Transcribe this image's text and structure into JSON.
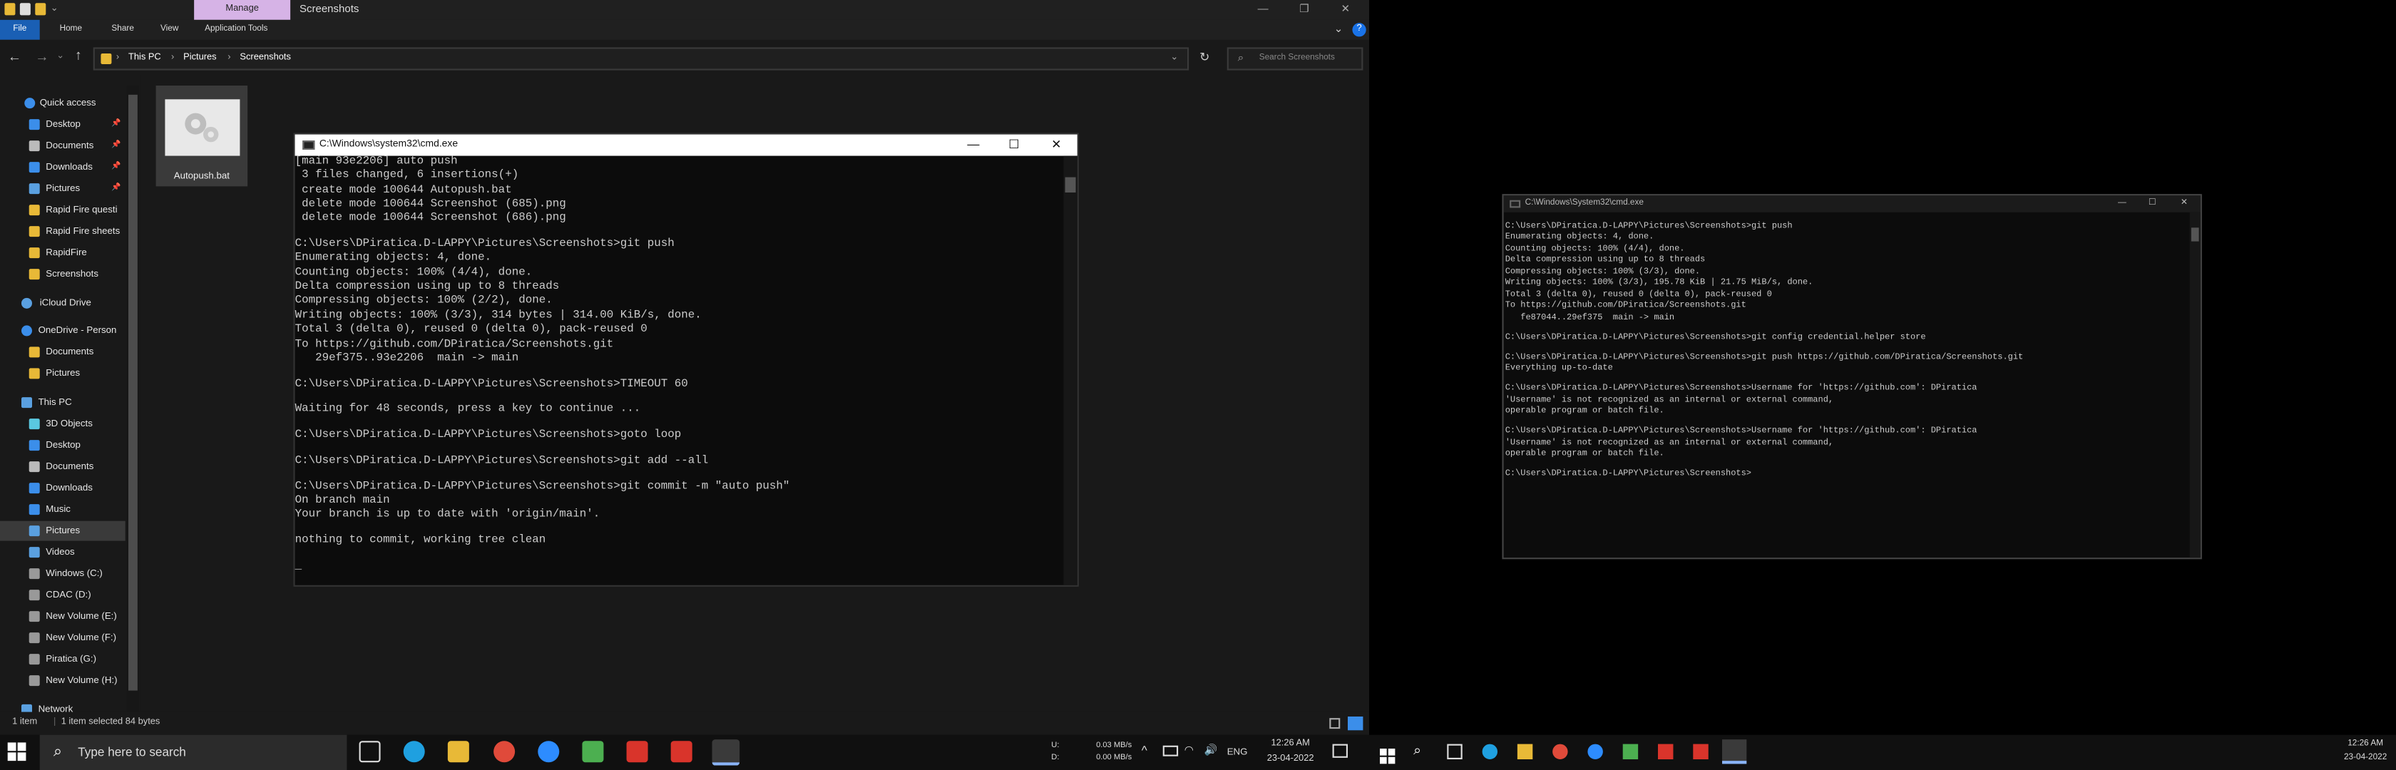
{
  "explorer": {
    "title": "Screenshots",
    "manage_tab": "Manage",
    "ribbon_tabs": [
      "File",
      "Home",
      "Share",
      "View",
      "Application Tools"
    ],
    "breadcrumb": [
      "This PC",
      "Pictures",
      "Screenshots"
    ],
    "search_placeholder": "Search Screenshots",
    "nav": {
      "quick_access": "Quick access",
      "items_pinned": [
        "Desktop",
        "Documents",
        "Downloads",
        "Pictures"
      ],
      "items_folders": [
        "Rapid Fire questi",
        "Rapid Fire sheets",
        "RapidFire",
        "Screenshots"
      ],
      "icloud": "iCloud Drive",
      "onedrive": "OneDrive - Person",
      "onedrive_items": [
        "Documents",
        "Pictures"
      ],
      "this_pc": "This PC",
      "this_pc_items": [
        "3D Objects",
        "Desktop",
        "Documents",
        "Downloads",
        "Music",
        "Pictures",
        "Videos",
        "Windows (C:)",
        "CDAC (D:)",
        "New Volume (E:)",
        "New Volume (F:)",
        "Piratica (G:)",
        "New Volume (H:)"
      ],
      "network": "Network"
    },
    "file": {
      "name": "Autopush.bat"
    },
    "status": {
      "count": "1 item",
      "selected": "1 item selected  84 bytes"
    }
  },
  "cmd_left": {
    "title": "C:\\Windows\\system32\\cmd.exe",
    "lines": [
      "[main 93e2206] auto push",
      " 3 files changed, 6 insertions(+)",
      " create mode 100644 Autopush.bat",
      " delete mode 100644 Screenshot (685).png",
      " delete mode 100644 Screenshot (686).png",
      "",
      "C:\\Users\\DPiratica.D-LAPPY\\Pictures\\Screenshots>git push",
      "Enumerating objects: 4, done.",
      "Counting objects: 100% (4/4), done.",
      "Delta compression using up to 8 threads",
      "Compressing objects: 100% (2/2), done.",
      "Writing objects: 100% (3/3), 314 bytes | 314.00 KiB/s, done.",
      "Total 3 (delta 0), reused 0 (delta 0), pack-reused 0",
      "To https://github.com/DPiratica/Screenshots.git",
      "   29ef375..93e2206  main -> main",
      "",
      "C:\\Users\\DPiratica.D-LAPPY\\Pictures\\Screenshots>TIMEOUT 60",
      "",
      "Waiting for 48 seconds, press a key to continue ...",
      "",
      "C:\\Users\\DPiratica.D-LAPPY\\Pictures\\Screenshots>goto loop",
      "",
      "C:\\Users\\DPiratica.D-LAPPY\\Pictures\\Screenshots>git add --all",
      "",
      "C:\\Users\\DPiratica.D-LAPPY\\Pictures\\Screenshots>git commit -m \"auto push\"",
      "On branch main",
      "Your branch is up to date with 'origin/main'.",
      "",
      "nothing to commit, working tree clean",
      "",
      "_"
    ]
  },
  "cmd_right": {
    "title": "C:\\Windows\\System32\\cmd.exe",
    "lines": [
      "C:\\Users\\DPiratica.D-LAPPY\\Pictures\\Screenshots>git push",
      "Enumerating objects: 4, done.",
      "Counting objects: 100% (4/4), done.",
      "Delta compression using up to 8 threads",
      "Compressing objects: 100% (3/3), done.",
      "Writing objects: 100% (3/3), 195.78 KiB | 21.75 MiB/s, done.",
      "Total 3 (delta 0), reused 0 (delta 0), pack-reused 0",
      "To https://github.com/DPiratica/Screenshots.git",
      "   fe87044..29ef375  main -> main",
      "",
      "C:\\Users\\DPiratica.D-LAPPY\\Pictures\\Screenshots>git config credential.helper store",
      "",
      "C:\\Users\\DPiratica.D-LAPPY\\Pictures\\Screenshots>git push https://github.com/DPiratica/Screenshots.git",
      "Everything up-to-date",
      "",
      "C:\\Users\\DPiratica.D-LAPPY\\Pictures\\Screenshots>Username for 'https://github.com': DPiratica",
      "'Username' is not recognized as an internal or external command,",
      "operable program or batch file.",
      "",
      "C:\\Users\\DPiratica.D-LAPPY\\Pictures\\Screenshots>Username for 'https://github.com': DPiratica",
      "'Username' is not recognized as an internal or external command,",
      "operable program or batch file.",
      "",
      "C:\\Users\\DPiratica.D-LAPPY\\Pictures\\Screenshots>"
    ]
  },
  "taskbar": {
    "search_placeholder": "Type here to search",
    "net_up_label": "U:",
    "net_down_label": "D:",
    "net_up": "0.03 MB/s",
    "net_down": "0.00 MB/s",
    "lang": "ENG",
    "time": "12:26 AM",
    "date": "23-04-2022"
  },
  "colors": {
    "accent": "#1a5fb4",
    "manage": "#d6b3e6",
    "folder": "#e8b937"
  }
}
